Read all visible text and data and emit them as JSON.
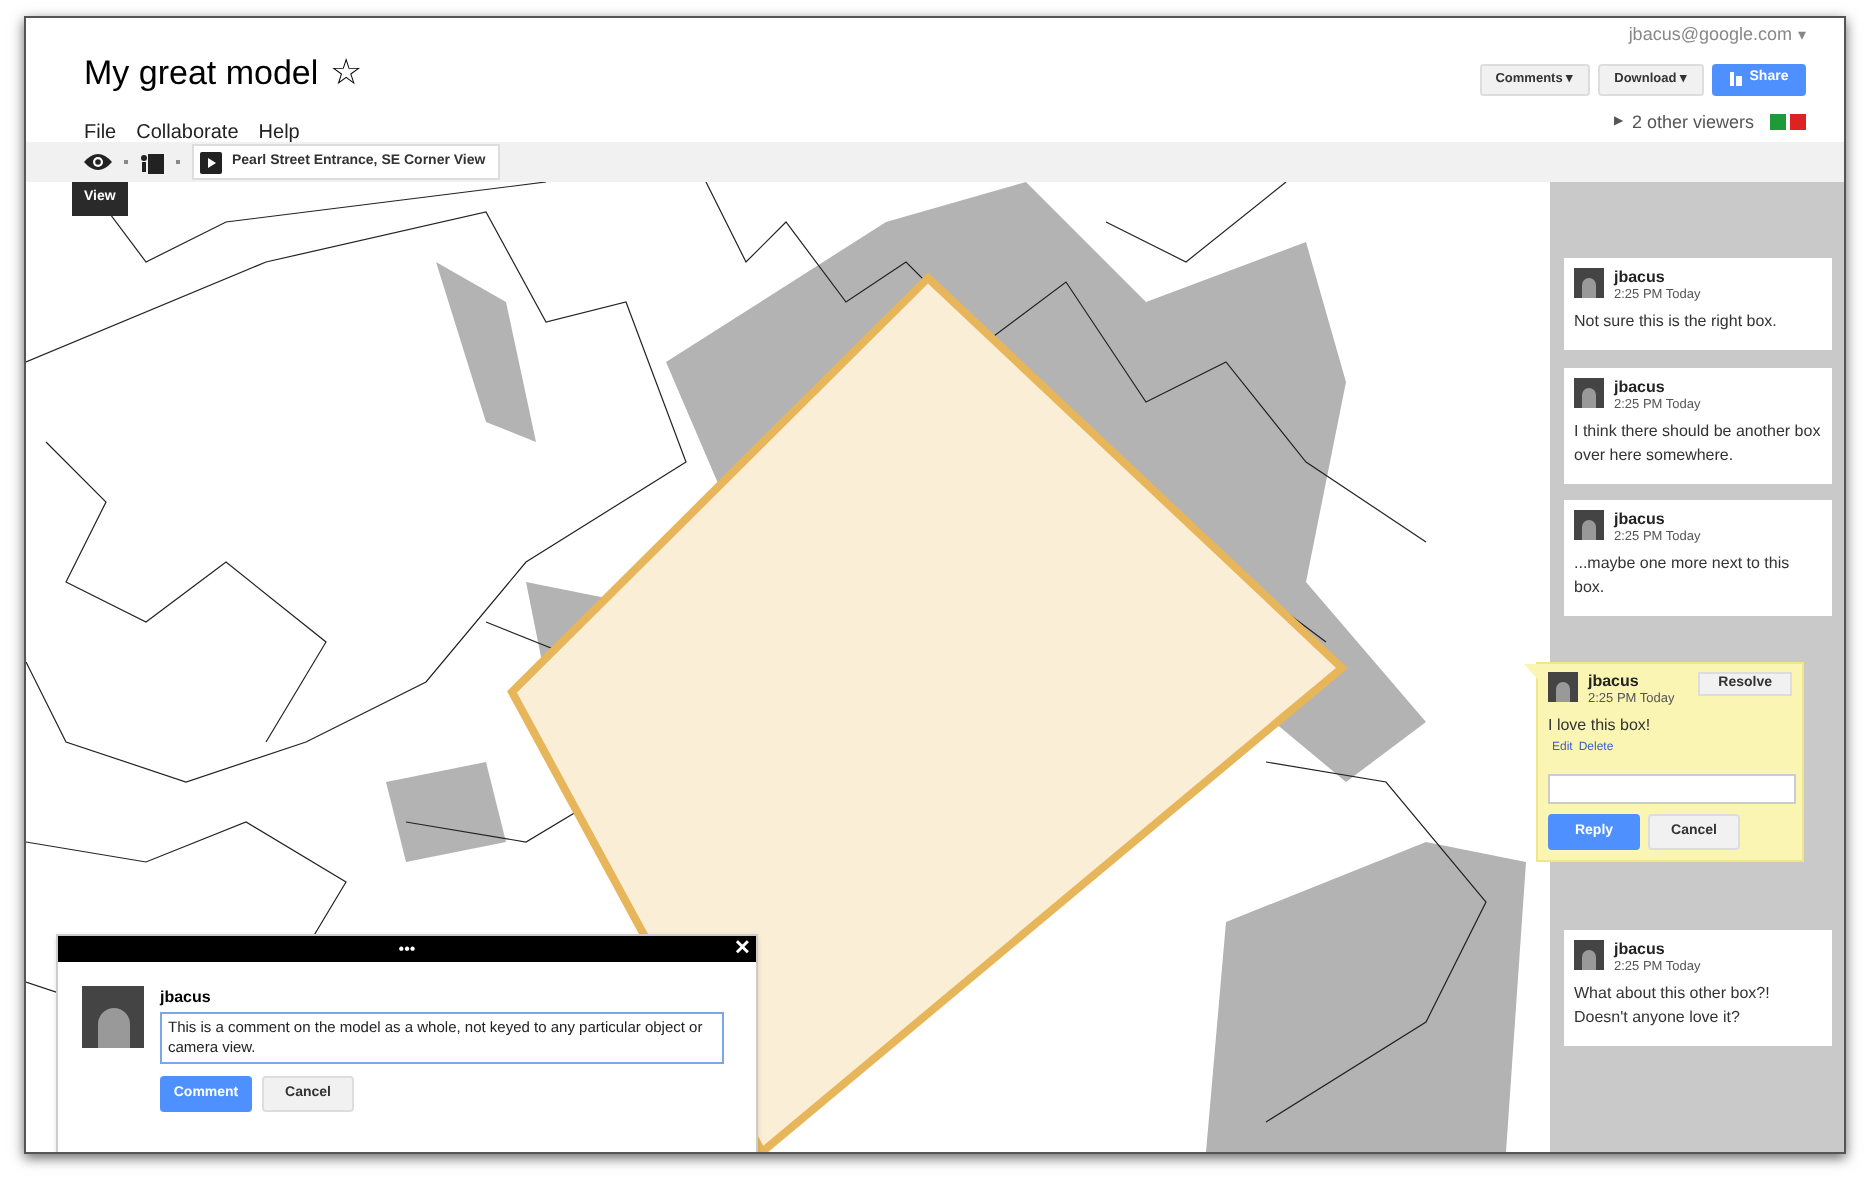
{
  "header": {
    "title": "My great model",
    "star": "☆",
    "account": "jbacus@google.com",
    "account_caret": "▾",
    "menu": [
      "File",
      "Collaborate",
      "Help"
    ],
    "buttons": [
      {
        "label": "Comments",
        "caret": "▾",
        "kind": "menu"
      },
      {
        "label": "Download",
        "caret": "▾",
        "kind": "menu"
      },
      {
        "label": "Share",
        "kind": "primary"
      }
    ],
    "viewers": {
      "toggle": "▶",
      "label": "2 other viewers",
      "swatches": [
        {
          "color": "#1e9a3a"
        },
        {
          "color": "#dd2222"
        }
      ]
    }
  },
  "toolbar": {
    "tooltip": "View",
    "scene": "Pearl Street Entrance, SE Corner View"
  },
  "sidebar": {
    "comments": [
      {
        "author": "jbacus",
        "time": "2:25 PM Today",
        "text": "Not sure this is the right box.",
        "selected": false
      },
      {
        "author": "jbacus",
        "time": "2:25 PM Today",
        "text": "I think there should be another box over here somewhere.",
        "selected": false
      },
      {
        "author": "jbacus",
        "time": "2:25 PM Today",
        "text": "...maybe one more next to this box.",
        "selected": false
      },
      {
        "author": "jbacus",
        "time": "2:25 PM Today",
        "text": "I love this box!",
        "selected": true,
        "resolve": "Resolve",
        "actions": [
          "Edit",
          "Delete"
        ],
        "buttons": [
          "Reply",
          "Cancel"
        ]
      },
      {
        "author": "jbacus",
        "time": "2:25 PM Today",
        "text": "What about this other box?! Doesn't anyone love it?",
        "selected": false
      }
    ]
  },
  "comment_dialog": {
    "grip": "•••",
    "close": "✕",
    "author": "jbacus",
    "value": "This is a comment on the model as a whole, not keyed to any particular object or camera view.",
    "buttons": [
      "Comment",
      "Cancel"
    ]
  }
}
